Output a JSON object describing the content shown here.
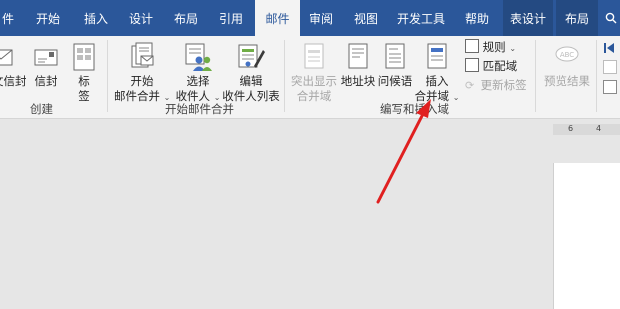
{
  "tabs": [
    {
      "label": "件"
    },
    {
      "label": "开始"
    },
    {
      "label": "插入"
    },
    {
      "label": "设计"
    },
    {
      "label": "布局"
    },
    {
      "label": "引用"
    },
    {
      "label": "邮件"
    },
    {
      "label": "审阅"
    },
    {
      "label": "视图"
    },
    {
      "label": "开发工具"
    },
    {
      "label": "帮助"
    },
    {
      "label": "表设计"
    },
    {
      "label": "布局"
    }
  ],
  "groups": {
    "create": {
      "label": "创建",
      "envelopes": "中文信封",
      "envelopes_visible": "文信封",
      "envelope": "信封",
      "labels_line1": "标",
      "labels_line2": "签"
    },
    "start": {
      "label": "开始邮件合并",
      "start_line1": "开始",
      "start_line2": "邮件合并",
      "select_line1": "选择",
      "select_line2": "收件人",
      "edit_line1": "编辑",
      "edit_line2": "收件人列表"
    },
    "write": {
      "label": "编写和插入域",
      "highlight_line1": "突出显示",
      "highlight_line2": "合并域",
      "address_block": "地址块",
      "greeting": "问候语",
      "insert_line1": "插入",
      "insert_line2": "合并域",
      "rules": "规则",
      "match_fields": "匹配域",
      "update_labels": "更新标签"
    },
    "preview": {
      "preview_results": "预览结果"
    }
  },
  "ruler": {
    "marks": [
      "6",
      "4"
    ]
  },
  "colors": {
    "ribbon_blue": "#2b579a",
    "arrow_red": "#e02020"
  }
}
